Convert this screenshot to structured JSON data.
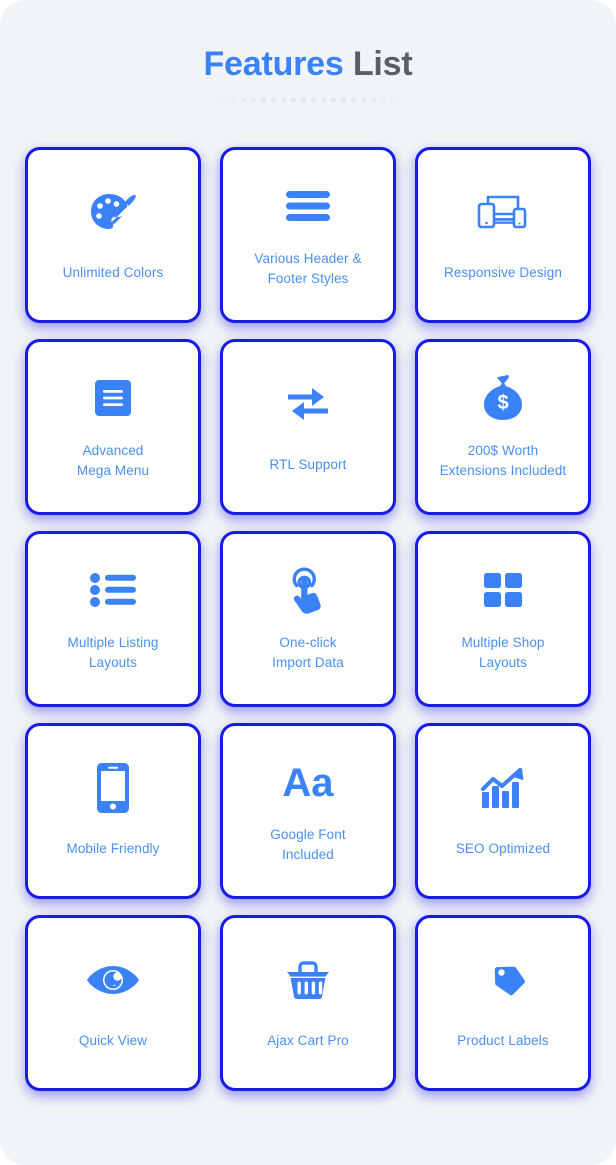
{
  "header": {
    "title_accent": "Features",
    "title_plain": "List",
    "divider_dot_count": 18
  },
  "theme": {
    "page_background": "#f1f4f6",
    "card_background": "#ffffff",
    "card_border": "#1a1ae8",
    "icon_color": "#3b82f6",
    "label_color": "#4a90f0",
    "title_accent_color": "#3b82f6",
    "title_plain_color": "#5a5f66"
  },
  "features": [
    {
      "icon": "palette-icon",
      "label": "Unlimited Colors"
    },
    {
      "icon": "hamburger-menu-icon",
      "label": "Various Header &\nFooter Styles"
    },
    {
      "icon": "responsive-devices-icon",
      "label": "Responsive Design"
    },
    {
      "icon": "mega-menu-icon",
      "label": "Advanced\nMega Menu"
    },
    {
      "icon": "exchange-arrows-icon",
      "label": "RTL Support"
    },
    {
      "icon": "money-bag-icon",
      "label": "200$ Worth\nExtensions Includedt"
    },
    {
      "icon": "bullet-list-icon",
      "label": "Multiple Listing\nLayouts"
    },
    {
      "icon": "tap-hand-icon",
      "label": "One-click\nImport Data"
    },
    {
      "icon": "grid-squares-icon",
      "label": "Multiple Shop\nLayouts"
    },
    {
      "icon": "mobile-phone-icon",
      "label": "Mobile Friendly"
    },
    {
      "icon": "typography-aa-icon",
      "label": "Google Font\nIncluded"
    },
    {
      "icon": "growth-chart-icon",
      "label": "SEO Optimized"
    },
    {
      "icon": "eye-icon",
      "label": "Quick View"
    },
    {
      "icon": "shopping-basket-icon",
      "label": "Ajax Cart Pro"
    },
    {
      "icon": "price-tags-icon",
      "label": "Product Labels"
    }
  ]
}
